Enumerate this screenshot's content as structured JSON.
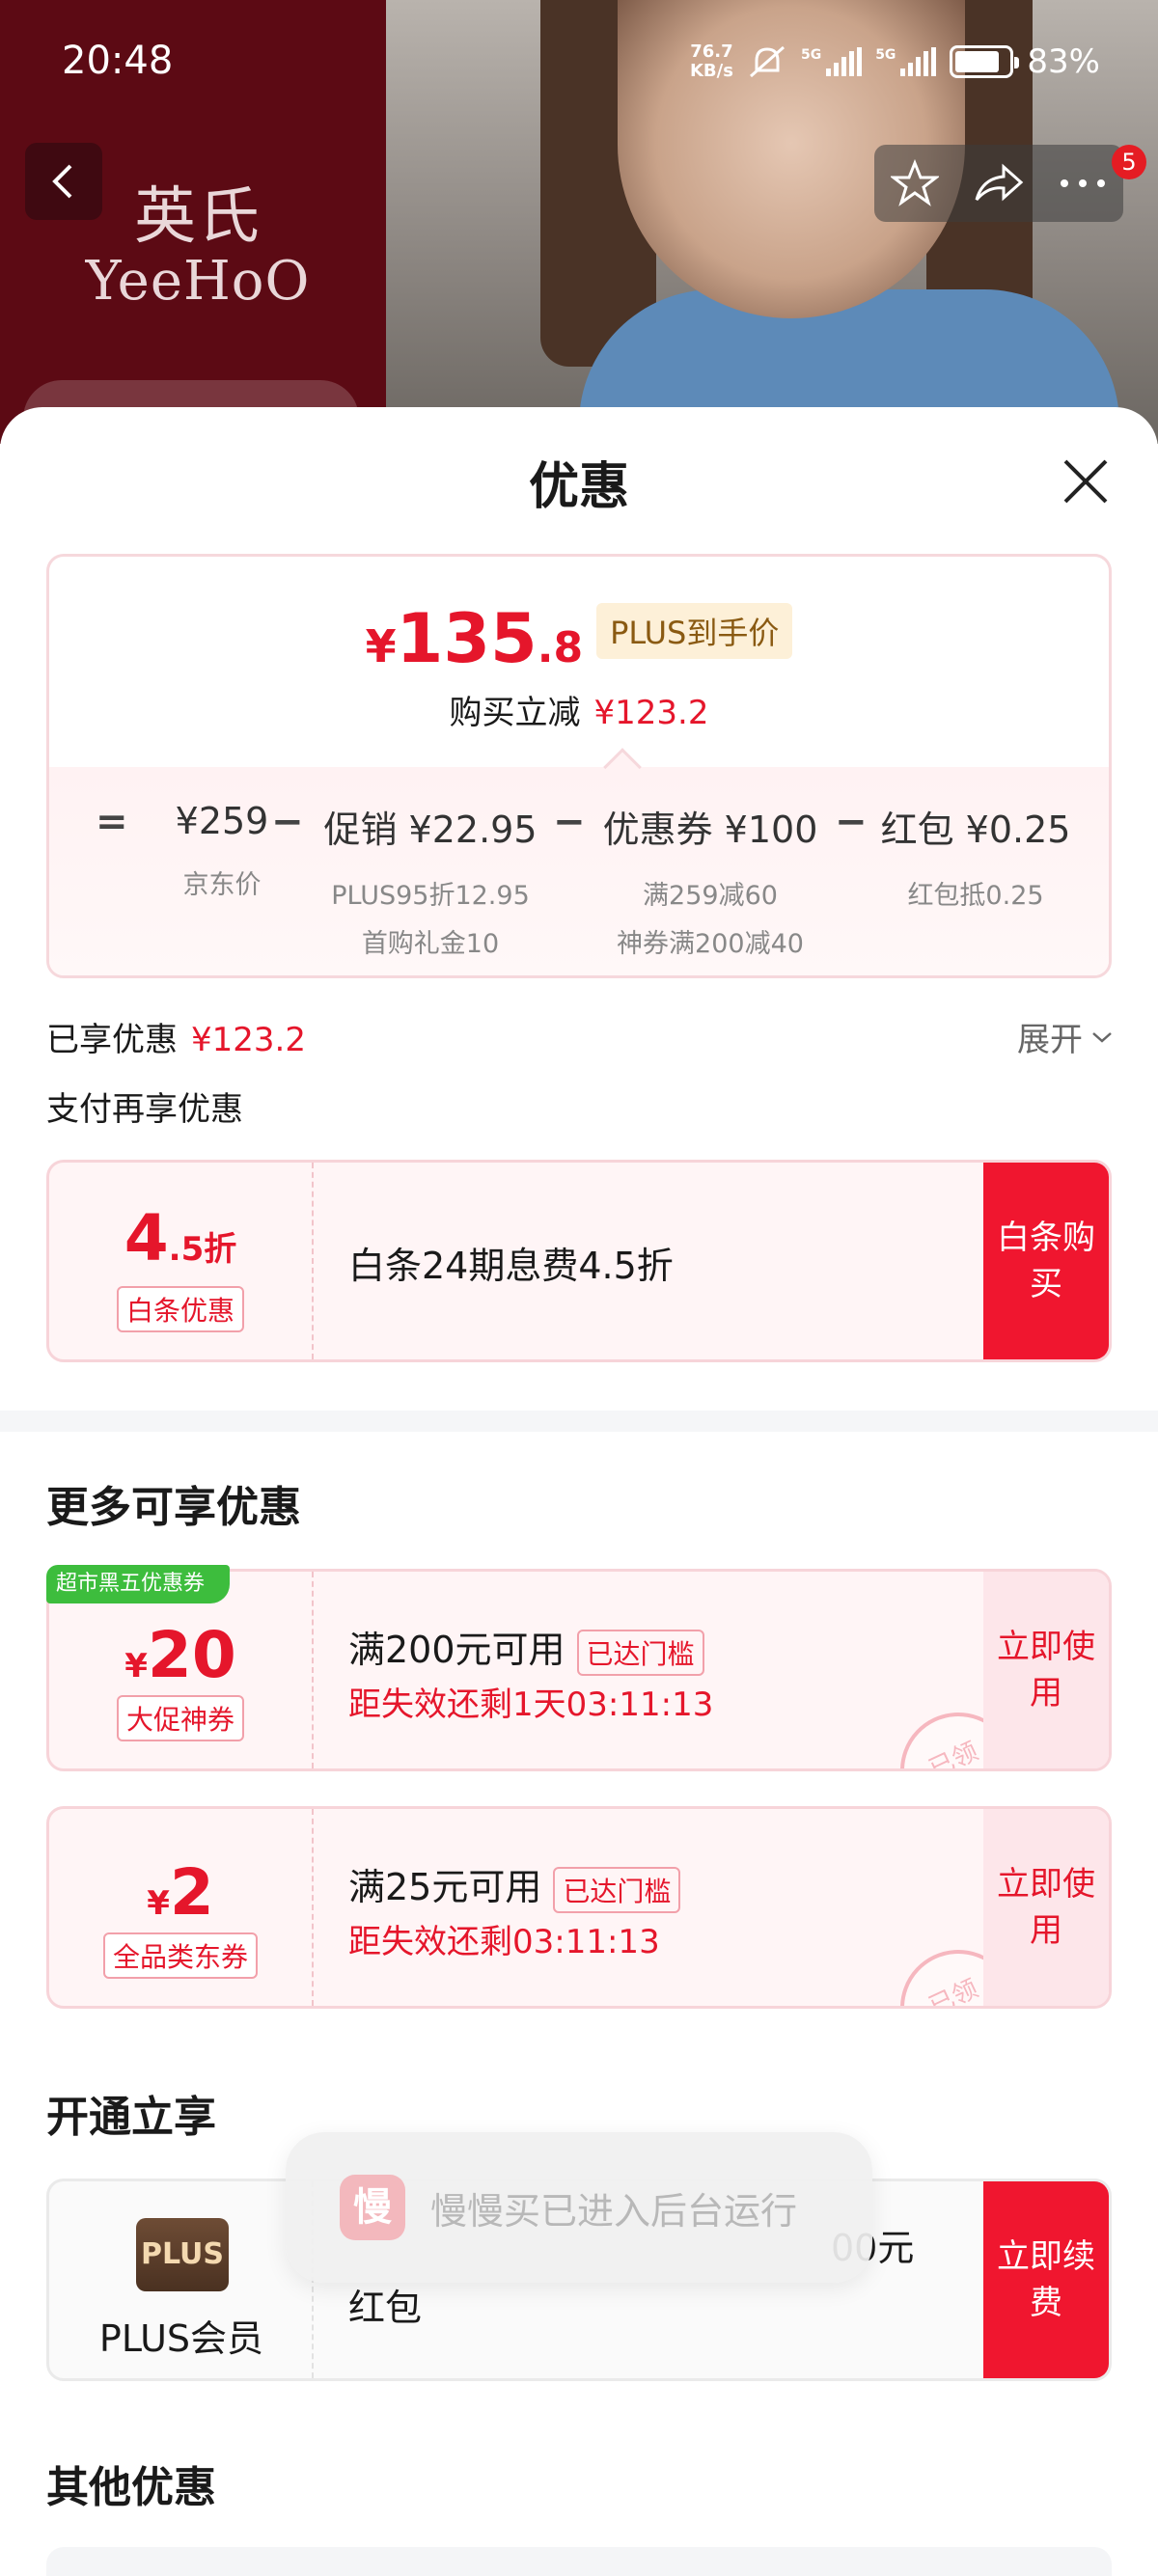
{
  "status": {
    "time": "20:48",
    "speed_top": "76.7",
    "speed_unit": "KB/s",
    "net1": "5G",
    "net2": "5G",
    "battery": "83%"
  },
  "background": {
    "brand_cn": "英氏",
    "brand_en": "YeeHoO",
    "notify_count": "5"
  },
  "sheet": {
    "title": "优惠"
  },
  "price": {
    "yuan": "¥",
    "int": "135",
    "dec": ".8",
    "plus_tag": "PLUS到手价",
    "reduce_label": "购买立减",
    "reduce_value": "¥123.2"
  },
  "breakdown": {
    "eq": "=",
    "minus": "−",
    "jd_price": "¥259",
    "jd_label": "京东价",
    "promo": "促销 ¥22.95",
    "promo_sub1": "PLUS95折12.95",
    "promo_sub2": "首购礼金10",
    "coupon": "优惠券 ¥100",
    "coupon_sub1": "满259减60",
    "coupon_sub2": "神券满200减40",
    "redpack": "红包 ¥0.25",
    "redpack_sub": "红包抵0.25"
  },
  "enjoyed": {
    "label": "已享优惠",
    "value": "¥123.2",
    "expand": "展开"
  },
  "pay_more": {
    "title": "支付再享优惠"
  },
  "baitiao": {
    "amount": "4",
    "amount_dec": ".5折",
    "tag": "白条优惠",
    "desc": "白条24期息费4.5折",
    "action": "白条购买"
  },
  "more": {
    "title": "更多可享优惠"
  },
  "coupons": [
    {
      "corner": "超市黑五优惠券",
      "yuan": "¥",
      "amount": "20",
      "tag": "大促神券",
      "line1": "满200元可用",
      "reached": "已达门槛",
      "line2": "距失效还剩1天03:11:13",
      "action": "立即使用",
      "stamp": "已领"
    },
    {
      "yuan": "¥",
      "amount": "2",
      "tag": "全品类东券",
      "line1": "满25元可用",
      "reached": "已达门槛",
      "line2": "距失效还剩03:11:13",
      "action": "立即使用",
      "stamp": "已领"
    }
  ],
  "open": {
    "title": "开通立享",
    "logo": "PLUS",
    "name": "PLUS会员",
    "line1_tail": "00元",
    "line2": "红包",
    "action": "立即续费"
  },
  "toast": {
    "icon": "慢",
    "text": "慢慢买已进入后台运行"
  },
  "other": {
    "title": "其他优惠"
  },
  "colors": {
    "accent": "#e5162b",
    "plus_brown": "#4a3121",
    "green_tag": "#3dbd3d"
  }
}
